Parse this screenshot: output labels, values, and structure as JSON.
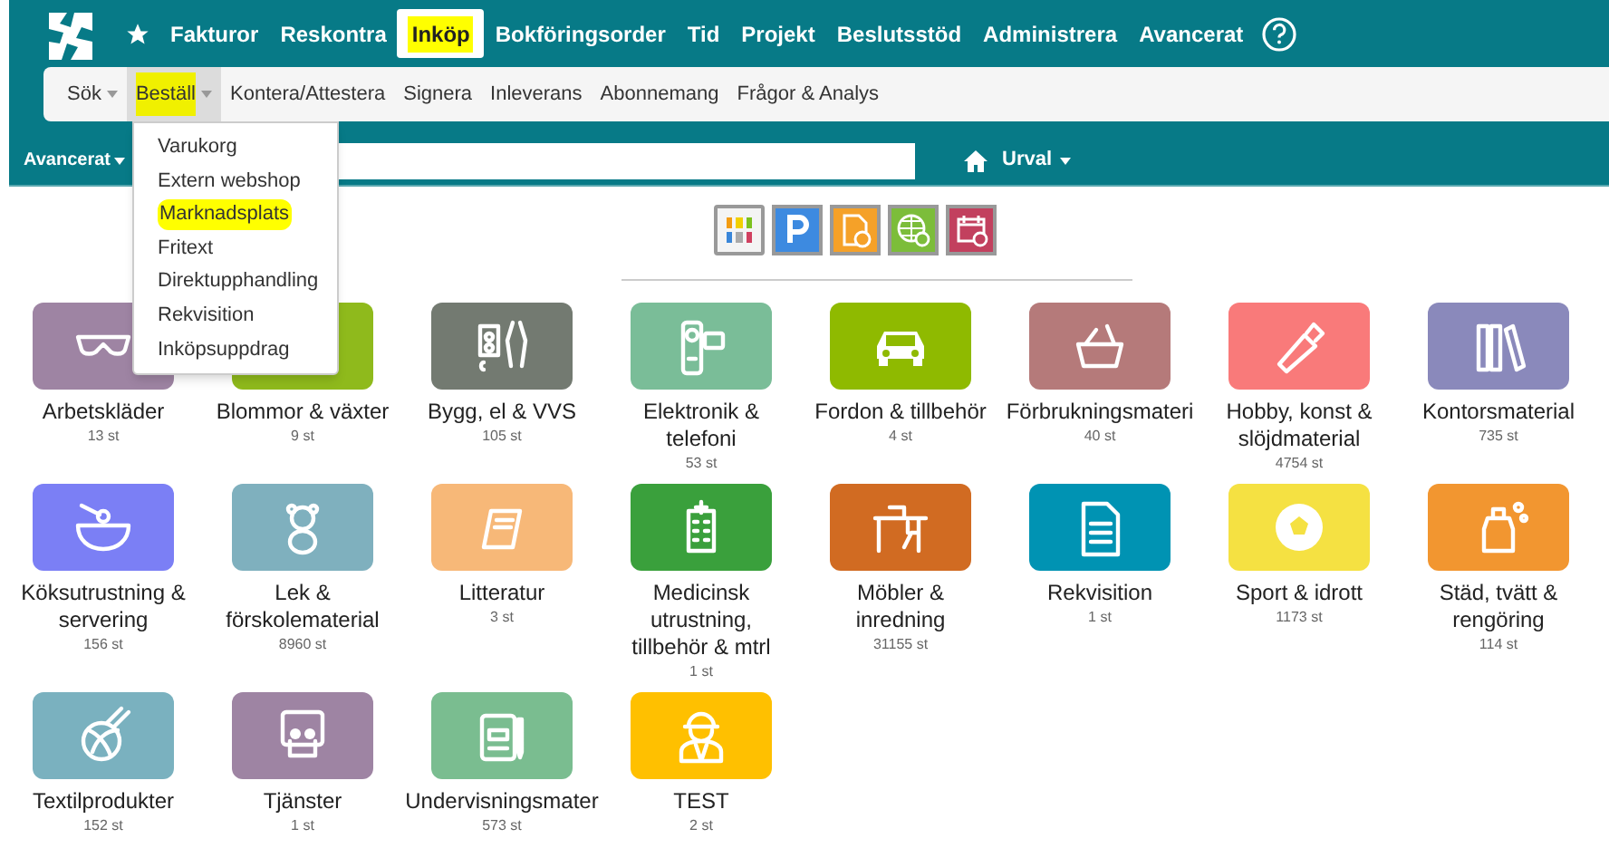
{
  "top_nav": {
    "items": [
      {
        "label": "Fakturor",
        "selected": false,
        "highlighted": false
      },
      {
        "label": "Reskontra",
        "selected": false,
        "highlighted": false
      },
      {
        "label": "Inköp",
        "selected": true,
        "highlighted": true
      },
      {
        "label": "Bokföringsorder",
        "selected": false,
        "highlighted": false
      },
      {
        "label": "Tid",
        "selected": false,
        "highlighted": false
      },
      {
        "label": "Projekt",
        "selected": false,
        "highlighted": false
      },
      {
        "label": "Beslutsstöd",
        "selected": false,
        "highlighted": false
      },
      {
        "label": "Administrera",
        "selected": false,
        "highlighted": false
      },
      {
        "label": "Avancerat",
        "selected": false,
        "highlighted": false
      }
    ]
  },
  "sub_nav": {
    "items": [
      {
        "label": "Sök",
        "dropdown": true,
        "selected": false,
        "highlighted": false
      },
      {
        "label": "Beställ",
        "dropdown": true,
        "selected": true,
        "highlighted": true
      },
      {
        "label": "Kontera/Attestera",
        "dropdown": false,
        "selected": false,
        "highlighted": false
      },
      {
        "label": "Signera",
        "dropdown": false,
        "selected": false,
        "highlighted": false
      },
      {
        "label": "Inleverans",
        "dropdown": false,
        "selected": false,
        "highlighted": false
      },
      {
        "label": "Abonnemang",
        "dropdown": false,
        "selected": false,
        "highlighted": false
      },
      {
        "label": "Frågor & Analys",
        "dropdown": false,
        "selected": false,
        "highlighted": false
      }
    ]
  },
  "search_bar": {
    "scope": "Avancerat",
    "view": "Urval"
  },
  "order_menu": {
    "items": [
      {
        "label": "Varukorg",
        "highlighted": false
      },
      {
        "label": "Extern webshop",
        "highlighted": false
      },
      {
        "label": "Marknadsplats",
        "highlighted": true
      },
      {
        "label": "Fritext",
        "highlighted": false
      },
      {
        "label": "Direktupphandling",
        "highlighted": false
      },
      {
        "label": "Rekvisition",
        "highlighted": false
      },
      {
        "label": "Inköpsuppdrag",
        "highlighted": false
      }
    ]
  },
  "categories": [
    {
      "name": "Arbetskläder",
      "count": "13 st",
      "color": "#9e84a3"
    },
    {
      "name": "Blommor & växter",
      "count": "9 st",
      "color": "#8fba1c"
    },
    {
      "name": "Bygg, el & VVS",
      "count": "105 st",
      "color": "#737a71"
    },
    {
      "name": "Elektronik & telefoni",
      "count": "53 st",
      "color": "#7abd98"
    },
    {
      "name": "Fordon & tillbehör",
      "count": "4 st",
      "color": "#8fba00"
    },
    {
      "name": "Förbrukningsmateri",
      "count": "40 st",
      "color": "#b57a7a"
    },
    {
      "name": "Hobby, konst & slöjdmaterial",
      "count": "4754 st",
      "color": "#f97a7a"
    },
    {
      "name": "Kontorsmaterial",
      "count": "735 st",
      "color": "#8a89bb"
    },
    {
      "name": "Köksutrustning & servering",
      "count": "156 st",
      "color": "#7b7ff5"
    },
    {
      "name": "Lek & förskolematerial",
      "count": "8960 st",
      "color": "#7fb0be"
    },
    {
      "name": "Litteratur",
      "count": "3 st",
      "color": "#f7b878"
    },
    {
      "name": "Medicinsk utrustning, tillbehör & mtrl",
      "count": "1 st",
      "color": "#3aa03c"
    },
    {
      "name": "Möbler & inredning",
      "count": "31155 st",
      "color": "#d16b22"
    },
    {
      "name": "Rekvisition",
      "count": "1 st",
      "color": "#0093b3"
    },
    {
      "name": "Sport & idrott",
      "count": "1173 st",
      "color": "#f5e142"
    },
    {
      "name": "Städ, tvätt & rengöring",
      "count": "114 st",
      "color": "#f29630"
    },
    {
      "name": "Textilprodukter",
      "count": "152 st",
      "color": "#7ab1bf"
    },
    {
      "name": "Tjänster",
      "count": "1 st",
      "color": "#9e84a3"
    },
    {
      "name": "Undervisningsmater",
      "count": "573 st",
      "color": "#7abd90"
    },
    {
      "name": "TEST",
      "count": "2 st",
      "color": "#ffc000"
    }
  ]
}
